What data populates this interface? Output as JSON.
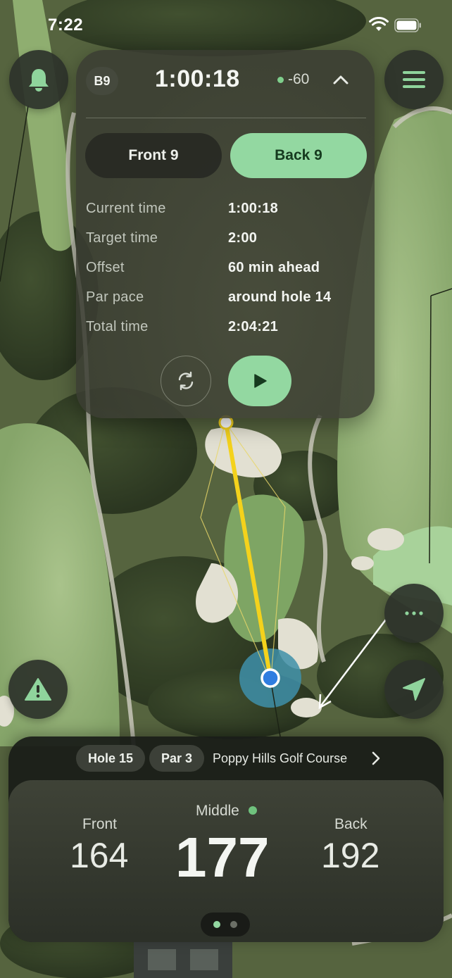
{
  "status_bar": {
    "time": "7:22"
  },
  "timer": {
    "side_badge": "B9",
    "elapsed": "1:00:18",
    "pace_offset": "-60",
    "segments": {
      "front": "Front 9",
      "back": "Back 9",
      "selected": "back"
    },
    "rows": [
      {
        "label": "Current time",
        "value": "1:00:18"
      },
      {
        "label": "Target time",
        "value": "2:00"
      },
      {
        "label": "Offset",
        "value": "60 min ahead"
      },
      {
        "label": "Par pace",
        "value": "around hole 14"
      },
      {
        "label": "Total time",
        "value": "2:04:21"
      }
    ]
  },
  "hole_info": {
    "hole": "Hole 15",
    "par": "Par 3",
    "course": "Poppy Hills Golf Course"
  },
  "distances": {
    "front_label": "Front",
    "front": "164",
    "middle_label": "Middle",
    "middle": "177",
    "back_label": "Back",
    "back": "192"
  },
  "pager": {
    "pages": 2,
    "current": 1
  },
  "icons": {
    "notifications": "bell-icon",
    "menu": "hamburger-menu-icon",
    "report": "warning-triangle-icon",
    "more": "ellipsis-icon",
    "locate": "location-arrow-icon",
    "reset": "refresh-icon",
    "play": "play-icon",
    "collapse": "chevron-up-icon",
    "course": "chevron-right-icon"
  },
  "colors": {
    "accent": "#93d8a1",
    "status_dot": "#7fcf8c",
    "shot_line": "#f4d21c",
    "player_dot": "#2f7de0"
  }
}
